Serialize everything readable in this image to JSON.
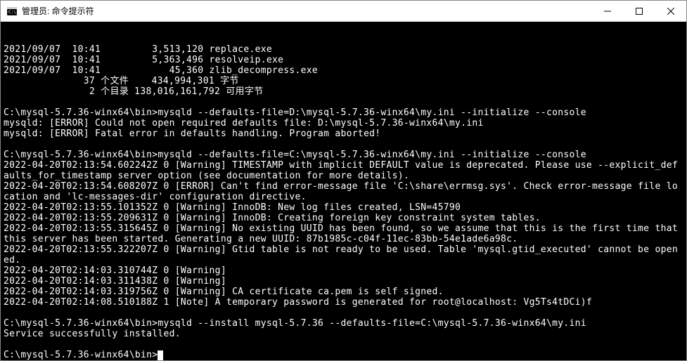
{
  "titlebar": {
    "title": "管理员: 命令提示符"
  },
  "terminal": {
    "lines": [
      "2021/09/07  10:41         3,513,120 replace.exe",
      "2021/09/07  10:41         5,363,496 resolveip.exe",
      "2021/09/07  10:41            45,360 zlib_decompress.exe",
      "              37 个文件    434,994,301 字节",
      "               2 个目录 138,016,161,792 可用字节",
      "",
      "C:\\mysql-5.7.36-winx64\\bin>mysqld --defaults-file=D:\\mysql-5.7.36-winx64\\my.ini --initialize --console",
      "mysqld: [ERROR] Could not open required defaults file: D:\\mysql-5.7.36-winx64\\my.ini",
      "mysqld: [ERROR] Fatal error in defaults handling. Program aborted!",
      "",
      "C:\\mysql-5.7.36-winx64\\bin>mysqld --defaults-file=C:\\mysql-5.7.36-winx64\\my.ini --initialize --console",
      "2022-04-20T02:13:54.602242Z 0 [Warning] TIMESTAMP with implicit DEFAULT value is deprecated. Please use --explicit_defaults_for_timestamp server option (see documentation for more details).",
      "2022-04-20T02:13:54.608207Z 0 [ERROR] Can't find error-message file 'C:\\share\\errmsg.sys'. Check error-message file location and 'lc-messages-dir' configuration directive.",
      "2022-04-20T02:13:55.101352Z 0 [Warning] InnoDB: New log files created, LSN=45790",
      "2022-04-20T02:13:55.209631Z 0 [Warning] InnoDB: Creating foreign key constraint system tables.",
      "2022-04-20T02:13:55.315645Z 0 [Warning] No existing UUID has been found, so we assume that this is the first time that this server has been started. Generating a new UUID: 87b1985c-c04f-11ec-83bb-54e1ade6a98c.",
      "2022-04-20T02:13:55.322207Z 0 [Warning] Gtid table is not ready to be used. Table 'mysql.gtid_executed' cannot be opened.",
      "2022-04-20T02:14:03.310744Z 0 [Warning]",
      "2022-04-20T02:14:03.311438Z 0 [Warning]",
      "2022-04-20T02:14:03.319756Z 0 [Warning] CA certificate ca.pem is self signed.",
      "2022-04-20T02:14:08.510188Z 1 [Note] A temporary password is generated for root@localhost: Vg5Ts4tDCi)f",
      "",
      "C:\\mysql-5.7.36-winx64\\bin>mysqld --install mysql-5.7.36 --defaults-file=C:\\mysql-5.7.36-winx64\\my.ini",
      "Service successfully installed.",
      "",
      "C:\\mysql-5.7.36-winx64\\bin>"
    ]
  }
}
